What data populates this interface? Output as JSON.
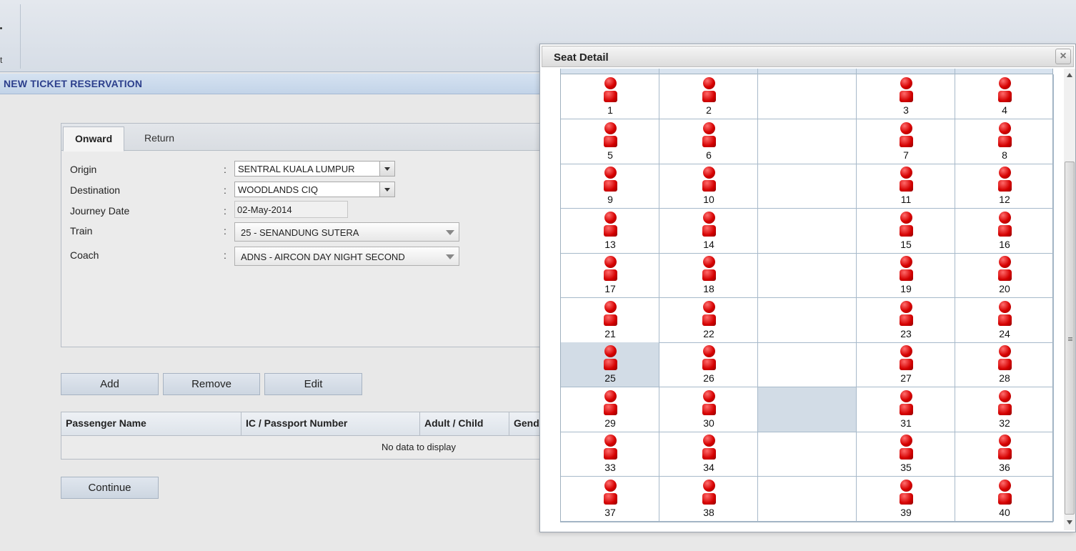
{
  "toolbar": {
    "partial_label": "t"
  },
  "section": {
    "title": "NEW TICKET RESERVATION"
  },
  "tabs": [
    {
      "label": "Onward",
      "active": true
    },
    {
      "label": "Return",
      "active": false
    }
  ],
  "form": {
    "origin": {
      "label": "Origin",
      "value": "SENTRAL KUALA LUMPUR"
    },
    "destination": {
      "label": "Destination",
      "value": "WOODLANDS CIQ"
    },
    "journey_date": {
      "label": "Journey Date",
      "value": "02-May-2014"
    },
    "train": {
      "label": "Train",
      "value": "25 - SENANDUNG SUTERA"
    },
    "coach": {
      "label": "Coach",
      "value": "ADNS - AIRCON DAY NIGHT SECOND"
    },
    "separator": ":"
  },
  "buttons": {
    "add": "Add",
    "remove": "Remove",
    "edit": "Edit",
    "continue": "Continue"
  },
  "grid": {
    "columns": [
      "Passenger Name",
      "IC / Passport Number",
      "Adult / Child",
      "Gend"
    ],
    "empty_text": "No data to display"
  },
  "dialog": {
    "title": "Seat Detail",
    "close_symbol": "×",
    "seat_color": "#d40000",
    "selected_color": "#d2dce6",
    "rows": [
      [
        "1",
        "2",
        "",
        "3",
        "4"
      ],
      [
        "5",
        "6",
        "",
        "7",
        "8"
      ],
      [
        "9",
        "10",
        "",
        "11",
        "12"
      ],
      [
        "13",
        "14",
        "",
        "15",
        "16"
      ],
      [
        "17",
        "18",
        "",
        "19",
        "20"
      ],
      [
        "21",
        "22",
        "",
        "23",
        "24"
      ],
      [
        "25",
        "26",
        "",
        "27",
        "28"
      ],
      [
        "29",
        "30",
        "",
        "31",
        "32"
      ],
      [
        "33",
        "34",
        "",
        "35",
        "36"
      ],
      [
        "37",
        "38",
        "",
        "39",
        "40"
      ]
    ],
    "selected_seat": "25",
    "highlighted_aisle_row": 7
  }
}
